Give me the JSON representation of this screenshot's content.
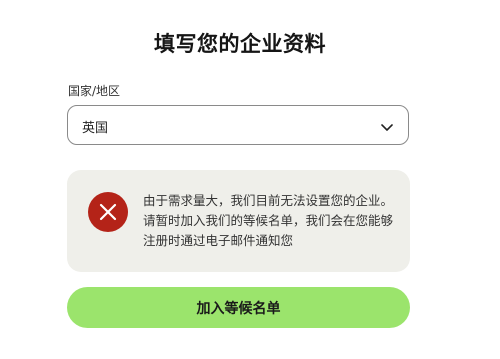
{
  "page": {
    "title": "填写您的企业资料"
  },
  "country_field": {
    "label": "国家/地区",
    "value": "英国"
  },
  "alert": {
    "icon": "close-icon",
    "message": "由于需求量大，我们目前无法设置您的企业。请暂时加入我们的等候名单，我们会在您能够注册时通过电子邮件通知您"
  },
  "actions": {
    "join_waitlist_label": "加入等候名单"
  },
  "colors": {
    "accent": "#9be46c",
    "error": "#b42318",
    "alert_background": "#efefea"
  }
}
